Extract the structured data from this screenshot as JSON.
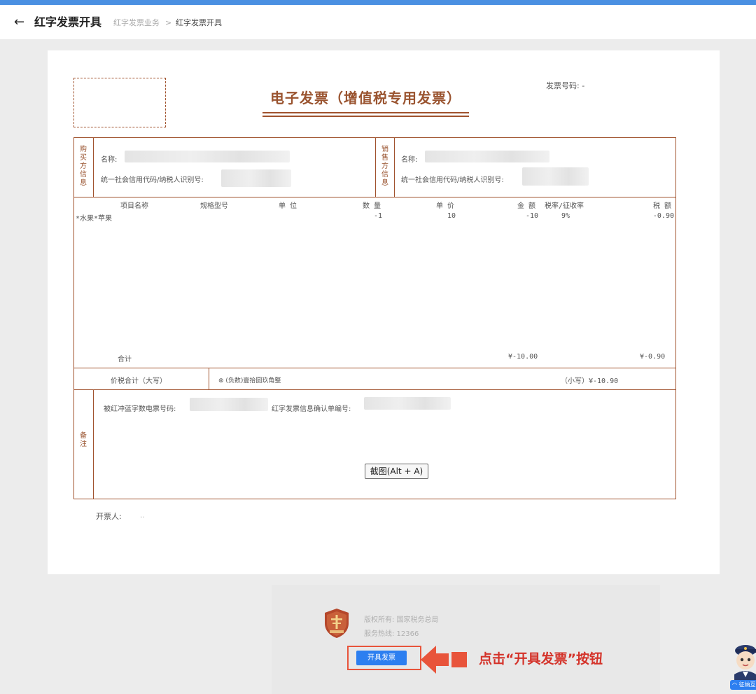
{
  "header": {
    "title": "红字发票开具",
    "breadcrumb": [
      "红字发票业务",
      "红字发票开具"
    ],
    "separator": ">"
  },
  "invoice": {
    "title": "电子发票（增值税专用发票）",
    "number_label": "发票号码: -",
    "buyer_section_label": [
      "购",
      "买",
      "方",
      "信",
      "息"
    ],
    "seller_section_label": [
      "销",
      "售",
      "方",
      "信",
      "息"
    ],
    "name_label": "名称:",
    "tax_id_label": "统一社会信用代码/纳税人识别号:",
    "columns": [
      "项目名称",
      "规格型号",
      "单 位",
      "数 量",
      "单 价",
      "金 额",
      "税率/征收率",
      "税 额"
    ],
    "items": [
      {
        "name": "*水果*苹果",
        "spec": "",
        "unit": "",
        "qty": "-1",
        "price": "10",
        "amount": "-10",
        "rate": "9%",
        "tax": "-0.90"
      }
    ],
    "total_label": "合计",
    "total_amount": "¥-10.00",
    "total_tax": "¥-0.90",
    "grand_total_label": "价税合计（大写）",
    "grand_total_words": "⊗ (负数)壹拾圆玖角整",
    "grand_total_small": "（小写）¥-10.90",
    "remarks_label": [
      "备",
      "注"
    ],
    "remark_blue_invoice_label": "被红冲蓝字数电票号码:",
    "remark_confirm_label": "红字发票信息确认单编号:",
    "issuer_label": "开票人:",
    "issuer_value": ".."
  },
  "screenshot_button": "截图(Alt + A)",
  "footer": {
    "copyright": "版权所有: 国家税务总局",
    "hotline": "服务热线: 12366"
  },
  "issue_button": "开具发票",
  "instruction": "点击“开具发票”按钮",
  "service_tag": "◠ 征纳互动",
  "colors": {
    "accent": "#2d7ff0",
    "invoice_brown": "#a0522d",
    "callout_red": "#e8543b"
  }
}
